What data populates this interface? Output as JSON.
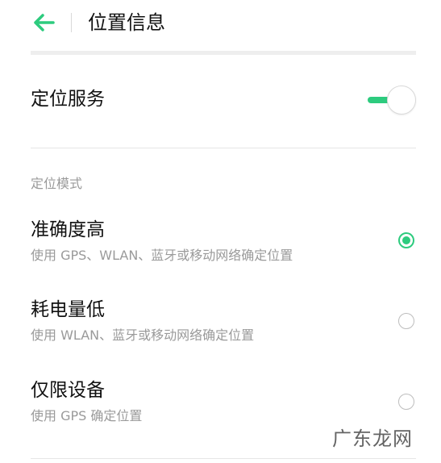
{
  "header": {
    "title": "位置信息",
    "back_icon": "arrow-left-icon"
  },
  "location_service": {
    "label": "定位服务",
    "toggle_on": true
  },
  "mode_section": {
    "label": "定位模式",
    "options": [
      {
        "title": "准确度高",
        "subtitle": "使用 GPS、WLAN、蓝牙或移动网络确定位置",
        "selected": true
      },
      {
        "title": "耗电量低",
        "subtitle": "使用 WLAN、蓝牙或移动网络确定位置",
        "selected": false
      },
      {
        "title": "仅限设备",
        "subtitle": "使用 GPS 确定位置",
        "selected": false
      }
    ]
  },
  "watermark": {
    "text": "广东龙网"
  },
  "colors": {
    "accent": "#2dcb7e",
    "title_text": "#111111",
    "secondary_text": "#9a9a9a",
    "divider": "#e6e6e6"
  }
}
